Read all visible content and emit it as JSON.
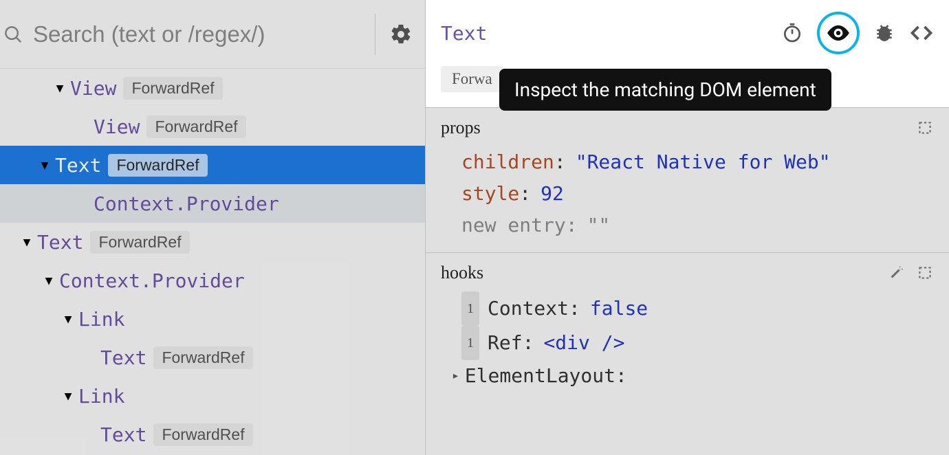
{
  "search": {
    "placeholder": "Search (text or /regex/)"
  },
  "tree": [
    {
      "name": "View",
      "badge": "ForwardRef",
      "indent": "indent-1",
      "tri": true,
      "sel": ""
    },
    {
      "name": "View",
      "badge": "ForwardRef",
      "indent": "indent-2",
      "tri": false,
      "sel": ""
    },
    {
      "name": "Text",
      "badge": "ForwardRef",
      "indent": "indent-3",
      "tri": true,
      "sel": "selected"
    },
    {
      "name": "Context.Provider",
      "badge": "",
      "indent": "indent-2",
      "tri": false,
      "sel": "selected-sub"
    },
    {
      "name": "Text",
      "badge": "ForwardRef",
      "indent": "indent-0b",
      "tri": true,
      "sel": ""
    },
    {
      "name": "Context.Provider",
      "badge": "",
      "indent": "indent-1b",
      "tri": true,
      "sel": ""
    },
    {
      "name": "Link",
      "badge": "",
      "indent": "indent-2b",
      "tri": true,
      "sel": ""
    },
    {
      "name": "Text",
      "badge": "ForwardRef",
      "indent": "indent-3b",
      "tri": false,
      "sel": ""
    },
    {
      "name": "Link",
      "badge": "",
      "indent": "indent-2b",
      "tri": true,
      "sel": ""
    },
    {
      "name": "Text",
      "badge": "ForwardRef",
      "indent": "indent-3b",
      "tri": false,
      "sel": ""
    }
  ],
  "detail": {
    "title": "Text",
    "rendered_by_badge": "Forwa",
    "tooltip": "Inspect the matching DOM element"
  },
  "props": {
    "heading": "props",
    "children_key": "children",
    "children_val": "\"React Native for Web\"",
    "style_key": "style",
    "style_val": "92",
    "new_entry_key": "new entry",
    "new_entry_val": "\"\""
  },
  "hooks": {
    "heading": "hooks",
    "items": [
      {
        "idx": "1",
        "name": "Context",
        "val": "false",
        "type": "bool"
      },
      {
        "idx": "1",
        "name": "Ref",
        "val": "<div />",
        "type": "el"
      }
    ],
    "elementlayout": "ElementLayout"
  }
}
